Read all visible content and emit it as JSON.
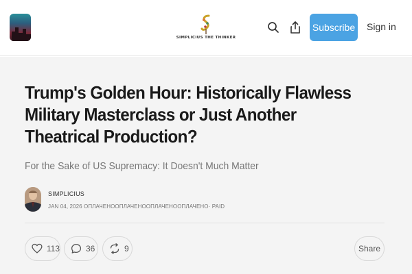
{
  "header": {
    "publication_name": "SIMPLICIUS THE THINKER",
    "subscribe_label": "Subscribe",
    "signin_label": "Sign in",
    "icons": [
      "app-logo",
      "search-icon",
      "share-icon"
    ]
  },
  "post": {
    "title": "Trump's Golden Hour: Historically Flawless Military Masterclass or Just Another Theatrical Production?",
    "subtitle": "For the Sake of US Supremacy: It Doesn't Much Matter",
    "author": "SIMPLICIUS",
    "meta": "JAN 04, 2026 ОПЛАЧЕНООПЛАЧЕНООПЛАЧЕНООПЛАЧЕНО· PAID"
  },
  "actions": {
    "likes": "113",
    "comments": "36",
    "restacks": "9",
    "share_label": "Share"
  },
  "colors": {
    "accent": "#4ba3e3",
    "background": "#f4f4f4"
  }
}
